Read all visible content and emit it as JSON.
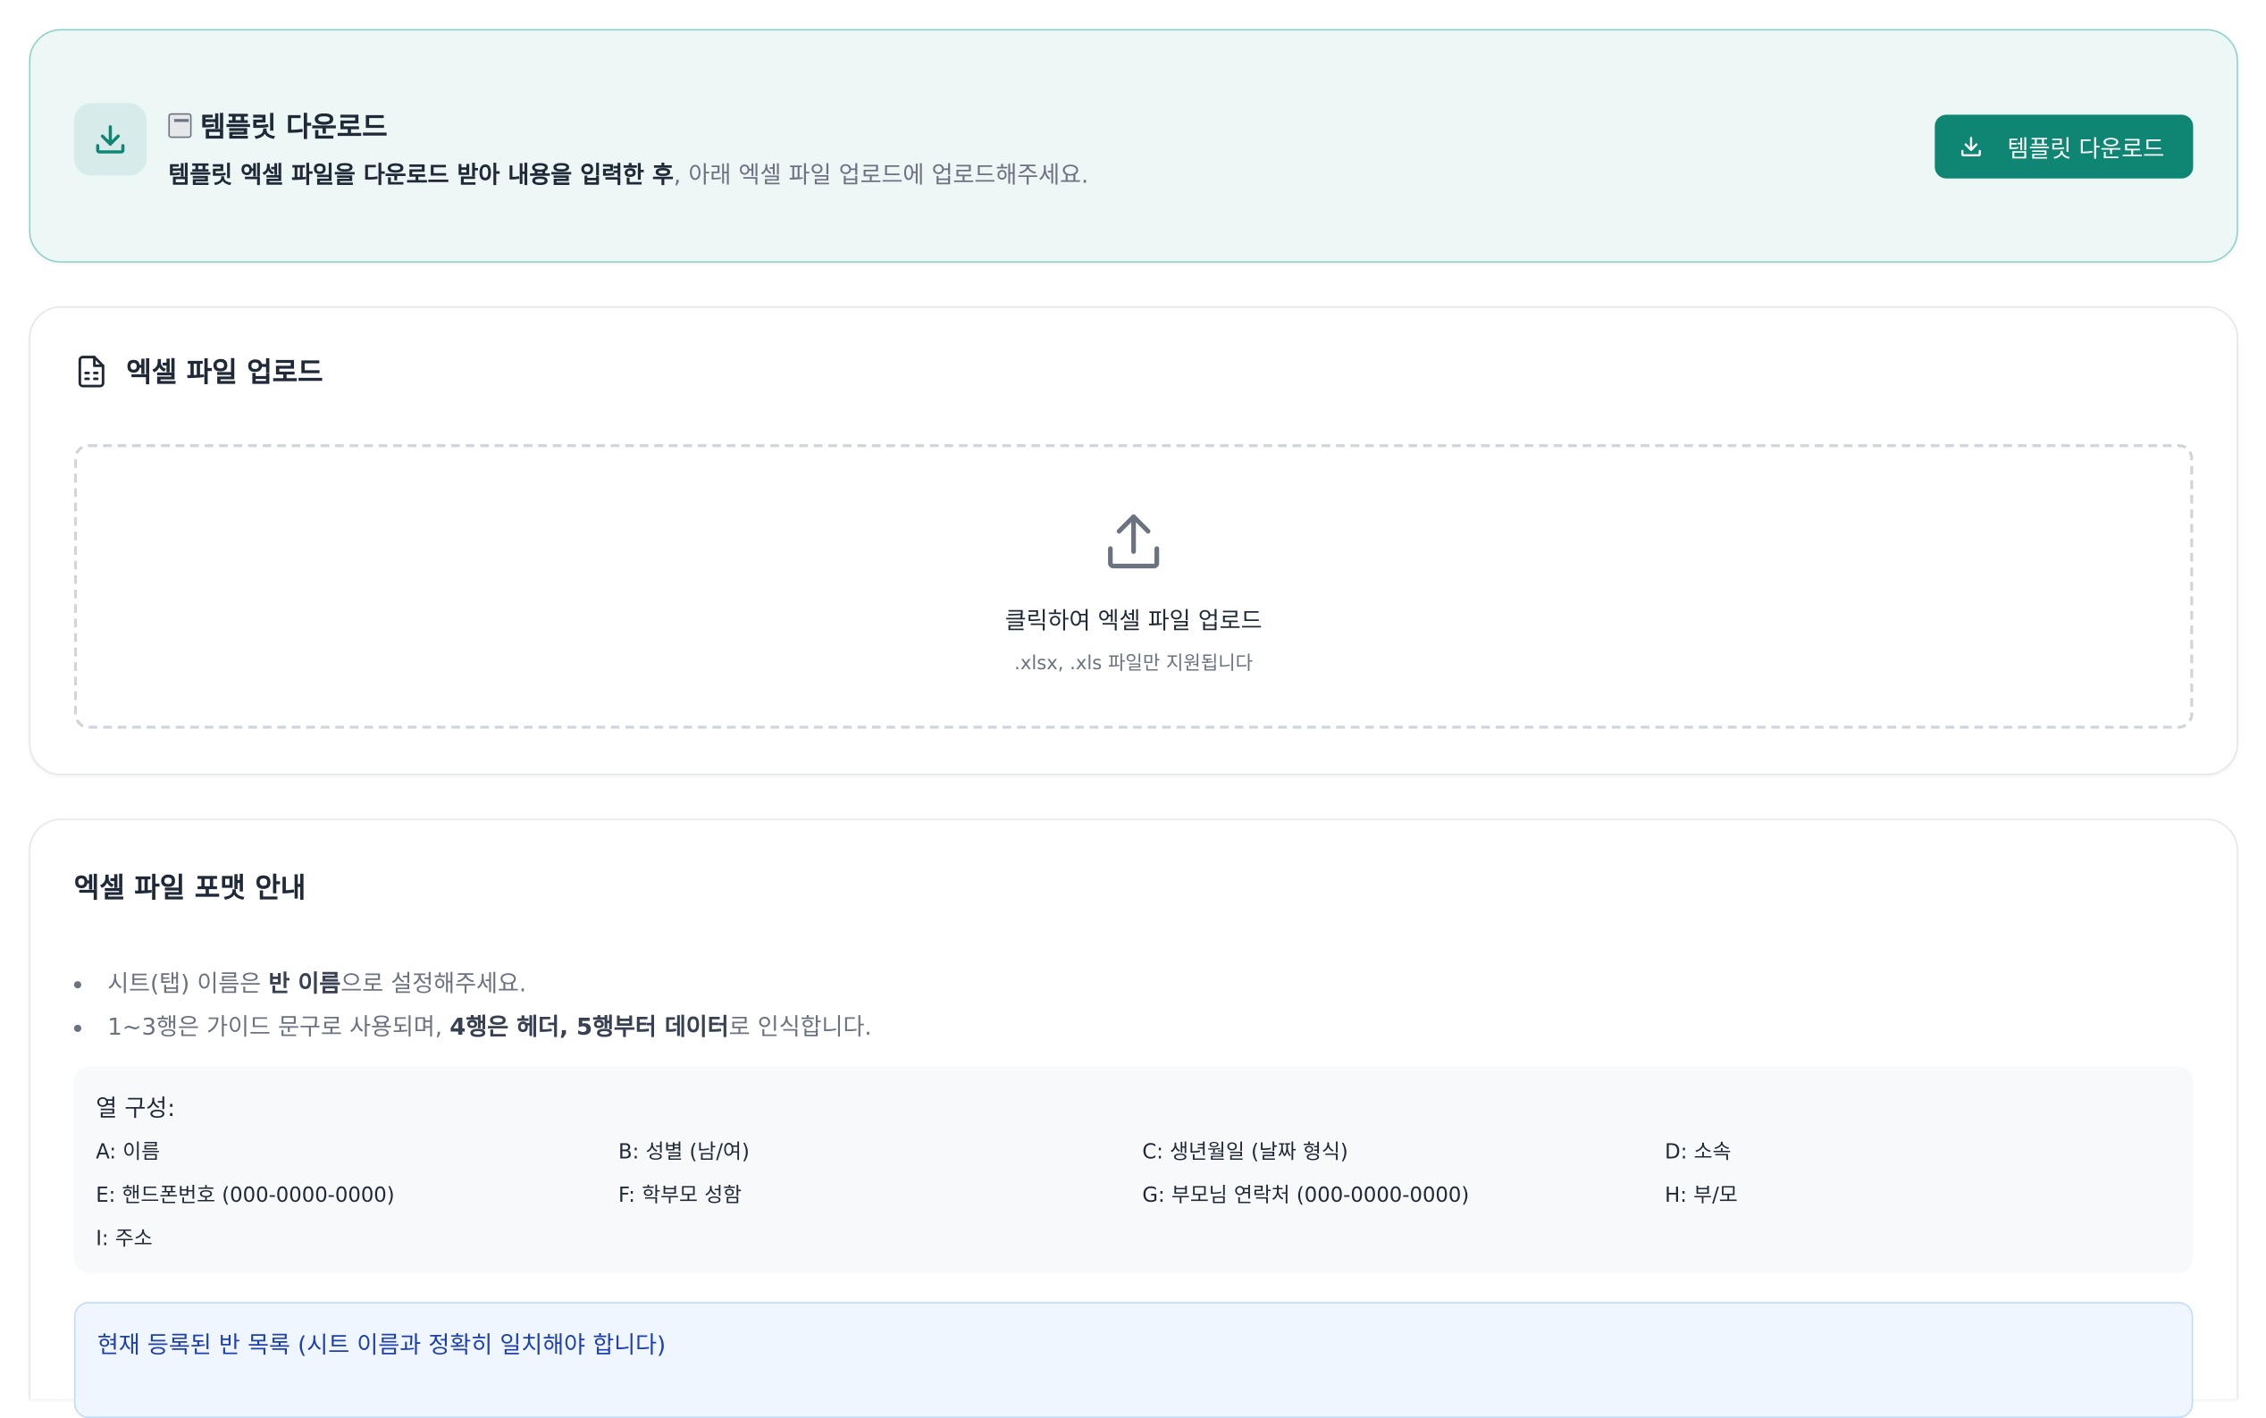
{
  "template": {
    "title": "템플릿 다운로드",
    "desc_bold": "템플릿 엑셀 파일을 다운로드 받아 내용을 입력한 후",
    "desc_rest": ", 아래 엑셀 파일 업로드에 업로드해주세요.",
    "button_label": "템플릿 다운로드"
  },
  "upload": {
    "title": "엑셀 파일 업로드",
    "dropzone_main": "클릭하여 엑셀 파일 업로드",
    "dropzone_sub": ".xlsx, .xls 파일만 지원됩니다"
  },
  "format": {
    "title": "엑셀 파일 포맷 안내",
    "bullet1": {
      "pre": "시트(탭) 이름은 ",
      "bold": "반 이름",
      "post": "으로 설정해주세요."
    },
    "bullet2": {
      "pre": "1~3행은 가이드 문구로 사용되며, ",
      "bold": "4행은 헤더, 5행부터 데이터",
      "post": "로 인식합니다."
    },
    "columns_title": "열 구성:",
    "columns": [
      "A: 이름",
      "B: 성별 (남/여)",
      "C: 생년월일 (날짜 형식)",
      "D: 소속",
      "E: 핸드폰번호 (000-0000-0000)",
      "F: 학부모 성함",
      "G: 부모님 연락처 (000-0000-0000)",
      "H: 부/모",
      "I: 주소"
    ],
    "classes_title": "현재 등록된 반 목록 (시트 이름과 정확히 일치해야 합니다)"
  }
}
